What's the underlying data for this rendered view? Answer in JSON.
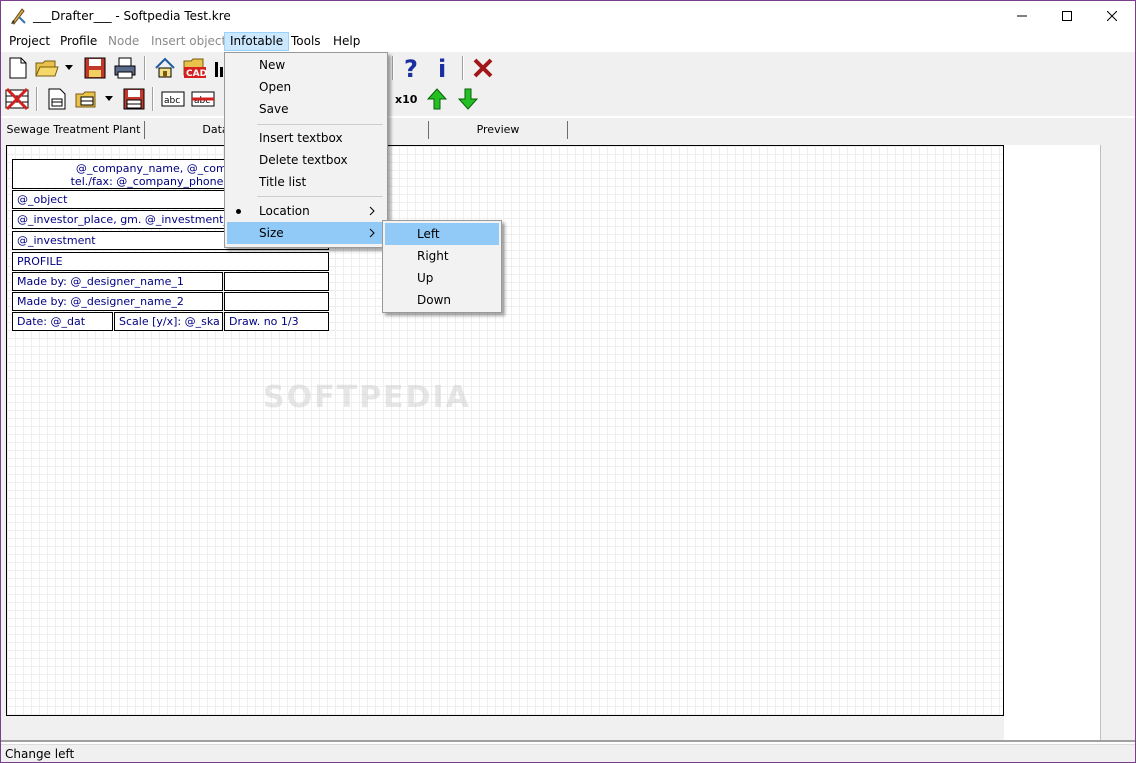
{
  "window": {
    "title": "___Drafter___ - Softpedia Test.kre"
  },
  "menubar": {
    "items": [
      {
        "label": "Project"
      },
      {
        "label": "Profile"
      },
      {
        "label": "Node"
      },
      {
        "label": "Insert object"
      },
      {
        "label": "Infotable"
      },
      {
        "label": "Tools"
      },
      {
        "label": "Help"
      }
    ]
  },
  "toolbar": {
    "zoom_label": "x10"
  },
  "tabs": [
    {
      "label": "Sewage Treatment Plant"
    },
    {
      "label": "Data"
    },
    {
      "label": "Preview"
    }
  ],
  "infotable": {
    "header_line1": "@_company_name, @_company_z",
    "header_line2": "tel./fax: @_company_phone, @_com",
    "object": "@_object",
    "investor": "@_investor_place, gm. @_investment_com",
    "investment": "@_investment",
    "profile": "PROFILE",
    "made_by_1": "Made by: @_designer_name_1",
    "made_by_2": "Made by: @_designer_name_2",
    "date": "Date: @_dat",
    "scale": "Scale [y/x]: @_ska",
    "drawing": "Draw. no 1/3"
  },
  "infotable_menu": {
    "new": "New",
    "open": "Open",
    "save": "Save",
    "insert_textbox": "Insert textbox",
    "delete_textbox": "Delete textbox",
    "title_list": "Title list",
    "location": "Location",
    "size": "Size"
  },
  "size_submenu": {
    "left": "Left",
    "right": "Right",
    "up": "Up",
    "down": "Down"
  },
  "watermark": "SOFTPEDIA",
  "statusbar": {
    "text": "Change left"
  },
  "colors": {
    "accent": "#91c9f7",
    "menubar_active": "#cce8ff",
    "table_text": "#000080",
    "window_border": "#7a3f8a"
  }
}
